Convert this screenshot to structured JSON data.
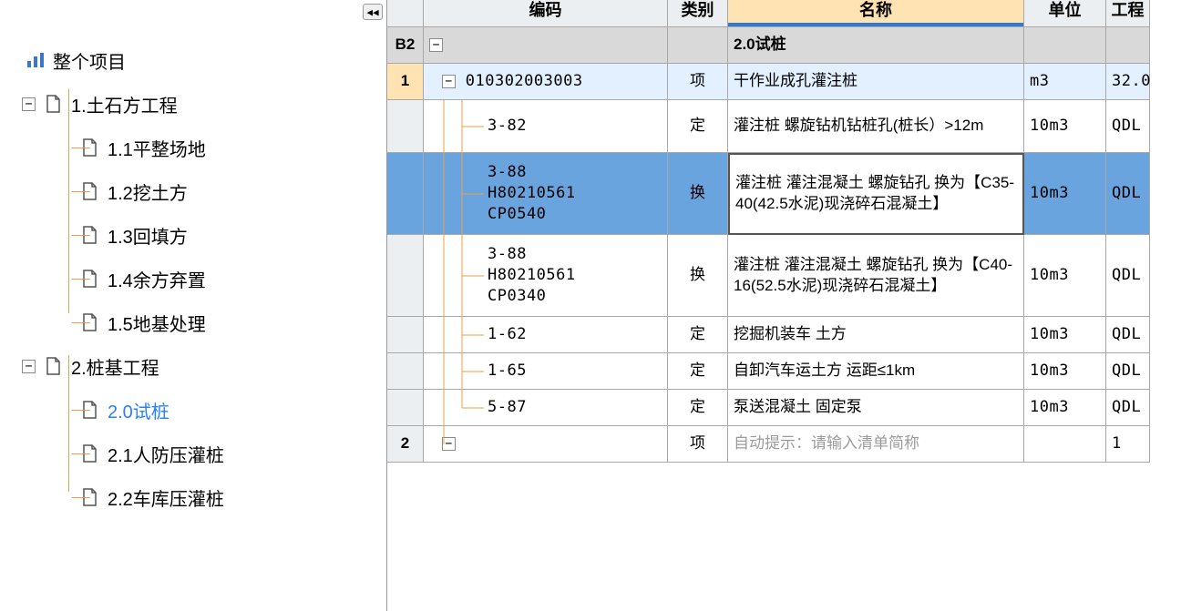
{
  "sidebar": {
    "root": {
      "label": "整个项目"
    },
    "group1": {
      "label": "1.土石方工程",
      "children": [
        {
          "label": "1.1平整场地"
        },
        {
          "label": "1.2挖土方"
        },
        {
          "label": "1.3回填方"
        },
        {
          "label": "1.4余方弃置"
        },
        {
          "label": "1.5地基处理"
        }
      ]
    },
    "group2": {
      "label": "2.桩基工程",
      "children": [
        {
          "label": "2.0试桩",
          "selected": true
        },
        {
          "label": "2.1人防压灌桩"
        },
        {
          "label": "2.2车库压灌桩"
        }
      ]
    }
  },
  "columns": {
    "code": "编码",
    "kind": "类别",
    "name": "名称",
    "unit": "单位",
    "eng": "工程"
  },
  "rows": [
    {
      "rownum": "B2",
      "code": "",
      "kind": "",
      "name": "2.0试桩",
      "unit": "",
      "eng": "",
      "style": "b2"
    },
    {
      "rownum": "1",
      "code": "010302003003",
      "kind": "项",
      "name": "干作业成孔灌注桩",
      "unit": "m3",
      "eng": "32.0",
      "style": "hl"
    },
    {
      "rownum": "",
      "code": "3-82",
      "kind": "定",
      "name": "灌注桩 螺旋钻机钻桩孔(桩长）>12m",
      "unit": "10m3",
      "eng": "QDL",
      "style": ""
    },
    {
      "rownum": "",
      "code": "3-88\nH80210561\nCP0540",
      "kind": "换",
      "name": "灌注桩 灌注混凝土 螺旋钻孔 换为【C35-40(42.5水泥)现浇碎石混凝土】",
      "unit": "10m3",
      "eng": "QDL",
      "style": "sel"
    },
    {
      "rownum": "",
      "code": "3-88\nH80210561\nCP0340",
      "kind": "换",
      "name": "灌注桩 灌注混凝土 螺旋钻孔 换为【C40-16(52.5水泥)现浇碎石混凝土】",
      "unit": "10m3",
      "eng": "QDL",
      "style": ""
    },
    {
      "rownum": "",
      "code": "1-62",
      "kind": "定",
      "name": "挖掘机装车 土方",
      "unit": "10m3",
      "eng": "QDL",
      "style": ""
    },
    {
      "rownum": "",
      "code": "1-65",
      "kind": "定",
      "name": "自卸汽车运土方 运距≤1km",
      "unit": "10m3",
      "eng": "QDL",
      "style": ""
    },
    {
      "rownum": "",
      "code": "5-87",
      "kind": "定",
      "name": "泵送混凝土 固定泵",
      "unit": "10m3",
      "eng": "QDL",
      "style": ""
    },
    {
      "rownum": "2",
      "code": "",
      "kind": "项",
      "name": "",
      "placeholder": "自动提示：请输入清单简称",
      "unit": "",
      "eng": "1",
      "style": ""
    }
  ],
  "icons": {
    "collapse": "◀◀"
  }
}
